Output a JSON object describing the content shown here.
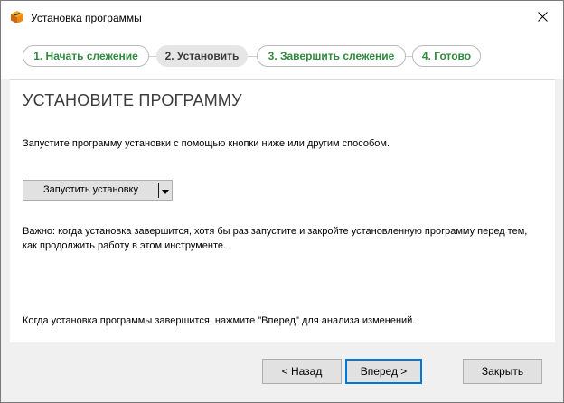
{
  "window": {
    "title": "Установка программы",
    "app_icon": "box-icon",
    "close_icon": "close-icon"
  },
  "steps": [
    {
      "label": "1. Начать слежение",
      "state": "done"
    },
    {
      "label": "2. Установить",
      "state": "active"
    },
    {
      "label": "3. Завершить слежение",
      "state": "pending"
    },
    {
      "label": "4. Готово",
      "state": "pending"
    }
  ],
  "main": {
    "heading": "УСТАНОВИТЕ ПРОГРАММУ",
    "instruction": "Запустите программу установки с помощью кнопки ниже или другим способом.",
    "launch_button": "Запустить установку",
    "note": "Важно: когда установка завершится, хотя бы раз запустите и закройте установленную программу перед тем, как продолжить работу в этом инструменте.",
    "footer_hint": "Когда установка программы завершится, нажмите \"Вперед\" для анализа изменений."
  },
  "buttons": {
    "back": "< Назад",
    "next": "Вперед >",
    "close": "Закрыть"
  },
  "colors": {
    "step_text": "#2e8b3d",
    "default_button_border": "#0078d7"
  }
}
